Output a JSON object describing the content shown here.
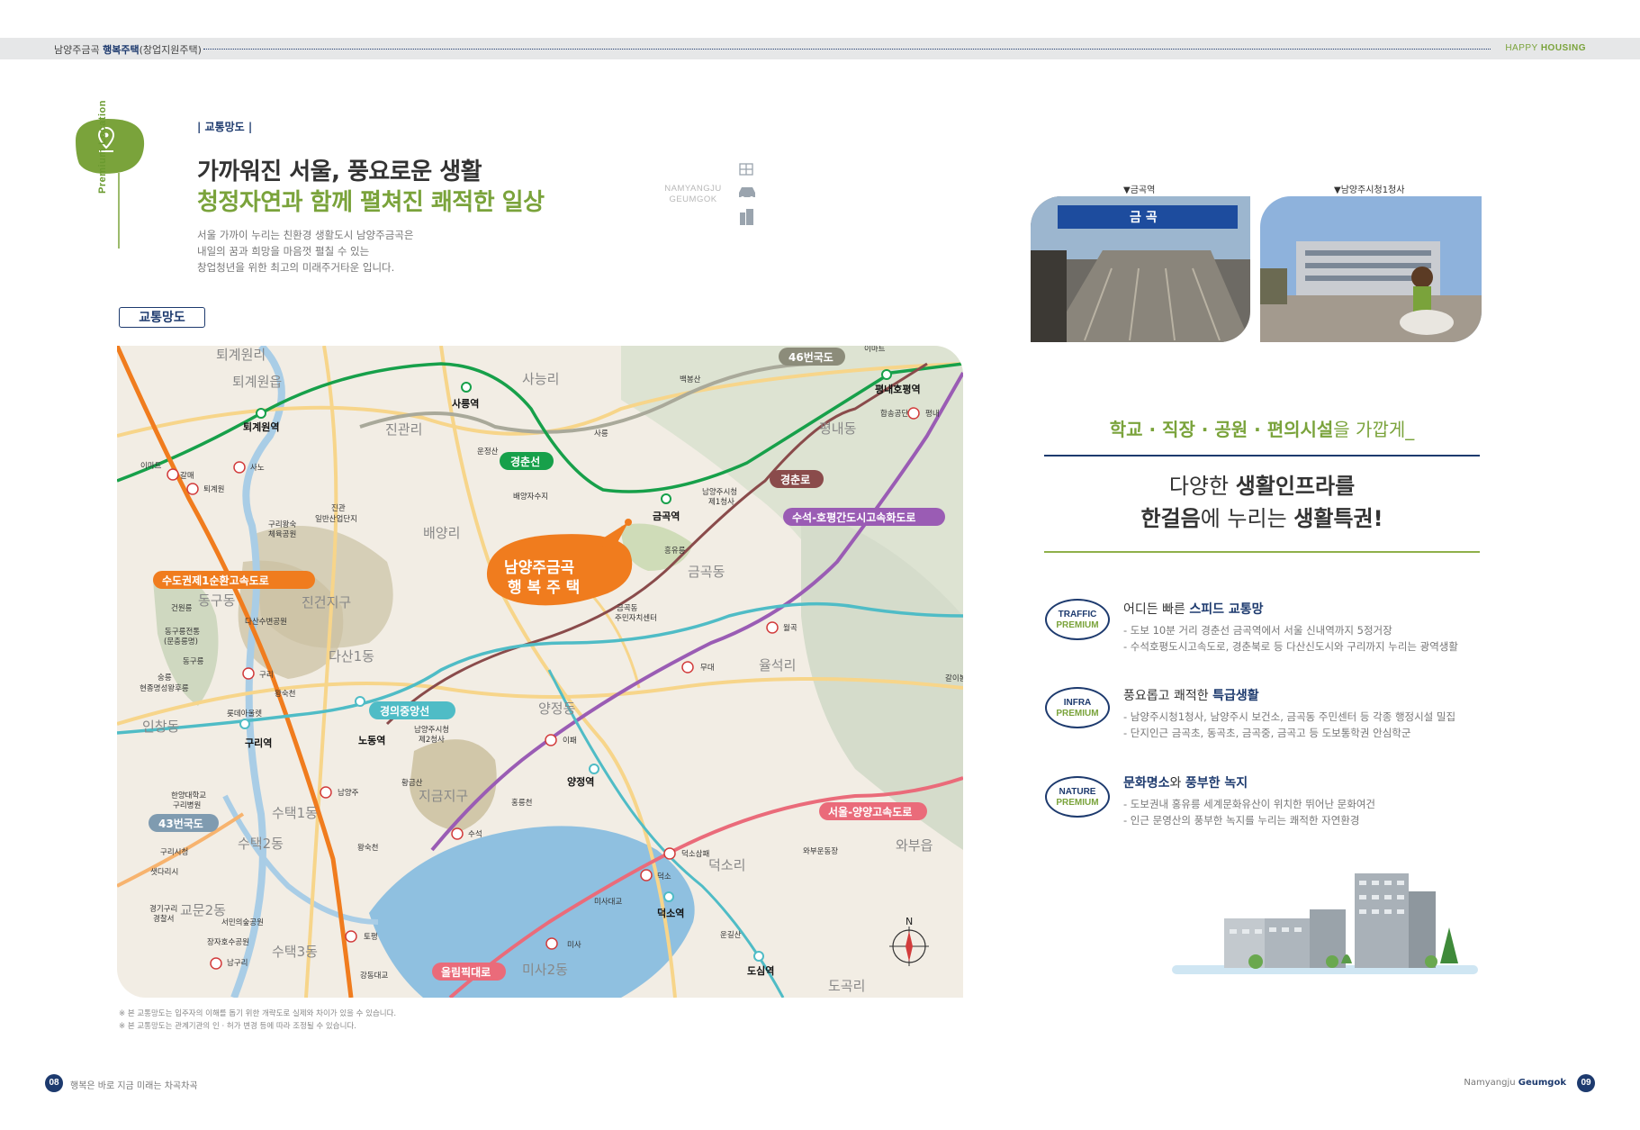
{
  "header": {
    "left_prefix": "남양주금곡 ",
    "left_bold": "행복주택",
    "left_suffix": "(창업지원주택)",
    "right_a": "HAPPY ",
    "right_b": "HOUSING"
  },
  "left_page": {
    "vertical_label": "Premium Location",
    "section_tag": "| 교통망도 |",
    "title_line1": "가까워진 서울, 풍요로운 생활",
    "title_line2": "청정자연과 함께 펼쳐진 쾌적한 일상",
    "desc_lines": [
      "서울 가까이 누리는 친환경 생활도시 남양주금곡은",
      "내일의 꿈과 희망을 마음껏 펼칠 수 있는",
      "창업청년을 위한 최고의 미래주거타운 입니다."
    ],
    "namyangju_line1": "NAMYANGJU",
    "namyangju_line2": "GEUMGOK",
    "map_button": "교통망도",
    "notes": [
      "※ 본 교통망도는 입주자의 이해를 돕기 위한 개략도로 실제와 차이가 있을 수 있습니다.",
      "※ 본 교통망도는 관계기관의 인 · 허가 변경 등에 따라 조정될 수 있습니다."
    ]
  },
  "map": {
    "callout_line1": "남양주금곡",
    "callout_line2": "행 복 주 택",
    "road_tags": [
      "46번국도",
      "경춘선",
      "경춘로",
      "수석-호평간도시고속화도로",
      "수도권제1순환고속도로",
      "경의중앙선",
      "43번국도",
      "서울-양양고속도로",
      "올림픽대로"
    ],
    "stations": [
      "퇴계원역",
      "사릉역",
      "금곡역",
      "평내호평역",
      "노동역",
      "구리역",
      "양정역",
      "덕소역",
      "도심역"
    ],
    "areas": [
      "퇴계원리",
      "퇴계원읍",
      "사능리",
      "진관리",
      "평내동",
      "배양리",
      "금곡동",
      "진건지구",
      "다산1동",
      "동구동",
      "율석리",
      "양정동",
      "인창동",
      "수택1동",
      "수택2동",
      "지금지구",
      "덕소리",
      "와부읍",
      "교문2동",
      "수택3동",
      "미사2동",
      "도곡리"
    ],
    "small": [
      "이마트",
      "갈매",
      "퇴계원",
      "사노",
      "진관",
      "일반산업단지",
      "구리왕숙",
      "체육공원",
      "배양자수지",
      "남양주시청",
      "제1청사",
      "흥유릉",
      "금곡동",
      "주민자치센터",
      "건원릉",
      "동구릉전통",
      "(문충릉명)",
      "동구릉",
      "다산수변공원",
      "숭릉",
      "현종명성왕후릉",
      "구리",
      "왕숙천",
      "롯데아울렛",
      "남양주시청",
      "제2청사",
      "이패",
      "남양주",
      "홍릉천",
      "한양대학교",
      "구리병원",
      "구리시청",
      "샛다리시",
      "왕숙천",
      "수석",
      "덕소삼패",
      "덕소",
      "미사대교",
      "와부운동장",
      "경기구리",
      "경찰서",
      "서민의숲공원",
      "장자호수공원",
      "남구리",
      "토평",
      "강동대교",
      "미사",
      "평내",
      "월곡",
      "평내",
      "합송공단",
      "무대",
      "사릉",
      "운정산",
      "백봉산",
      "갈이봉",
      "황금산",
      "운길산"
    ],
    "compass": "N"
  },
  "right_page": {
    "photo1_caption": "▼금곡역",
    "photo2_caption": "▼남양주시청1청사",
    "slogan_bold": "학교 · 직장 · 공원 · 편의시설",
    "slogan_rest": "을 가깝게_",
    "big_line1_a": "다양한 ",
    "big_line1_b": "생활인프라를",
    "big_line2_a": "한걸음",
    "big_line2_b": "에 누리는 ",
    "big_line2_c": "생활특권!",
    "features": [
      {
        "badge_top": "TRAFFIC",
        "badge_bottom": "PREMIUM",
        "title_a": "어디든 빠른 ",
        "title_b": "스피드 교통망",
        "lines": [
          "- 도보 10분 거리 경춘선 금곡역에서 서울 신내역까지 5정거장",
          "- 수석호평도시고속도로, 경춘북로 등 다산신도시와 구리까지 누리는 광역생활"
        ]
      },
      {
        "badge_top": "INFRA",
        "badge_bottom": "PREMIUM",
        "title_a": "풍요롭고 쾌적한 ",
        "title_b": "특급생활",
        "lines": [
          "- 남양주시청1청사, 남양주시 보건소, 금곡동 주민센터 등 각종 행정시설 밀집",
          "- 단지인근 금곡초, 동곡초, 금곡중, 금곡고 등 도보통학권 안심학군"
        ]
      },
      {
        "badge_top": "NATURE",
        "badge_bottom": "PREMIUM",
        "title_a": "문화명소",
        "title_mid": "와 ",
        "title_b": "풍부한 녹지",
        "lines": [
          "- 도보권내 홍유릉 세계문화유산이 위치한 뛰어난 문화여건",
          "- 인근 문영산의 풍부한 녹지를 누리는 쾌적한 자연환경"
        ]
      }
    ]
  },
  "footer": {
    "left_num": "08",
    "left_text": "행복은 바로 지금 미래는 차곡차곡",
    "right_a": "Namyangju ",
    "right_b": "Geumgok",
    "right_num": "09"
  },
  "colors": {
    "navy": "#1d3a6e",
    "green": "#7aa33b",
    "orange": "#f07c1e",
    "line_green": "#17a04a",
    "line_teal": "#4fbcc6",
    "line_purple": "#9a5cb4",
    "line_brown": "#8a4b4b",
    "line_pink": "#ea6b7a"
  }
}
